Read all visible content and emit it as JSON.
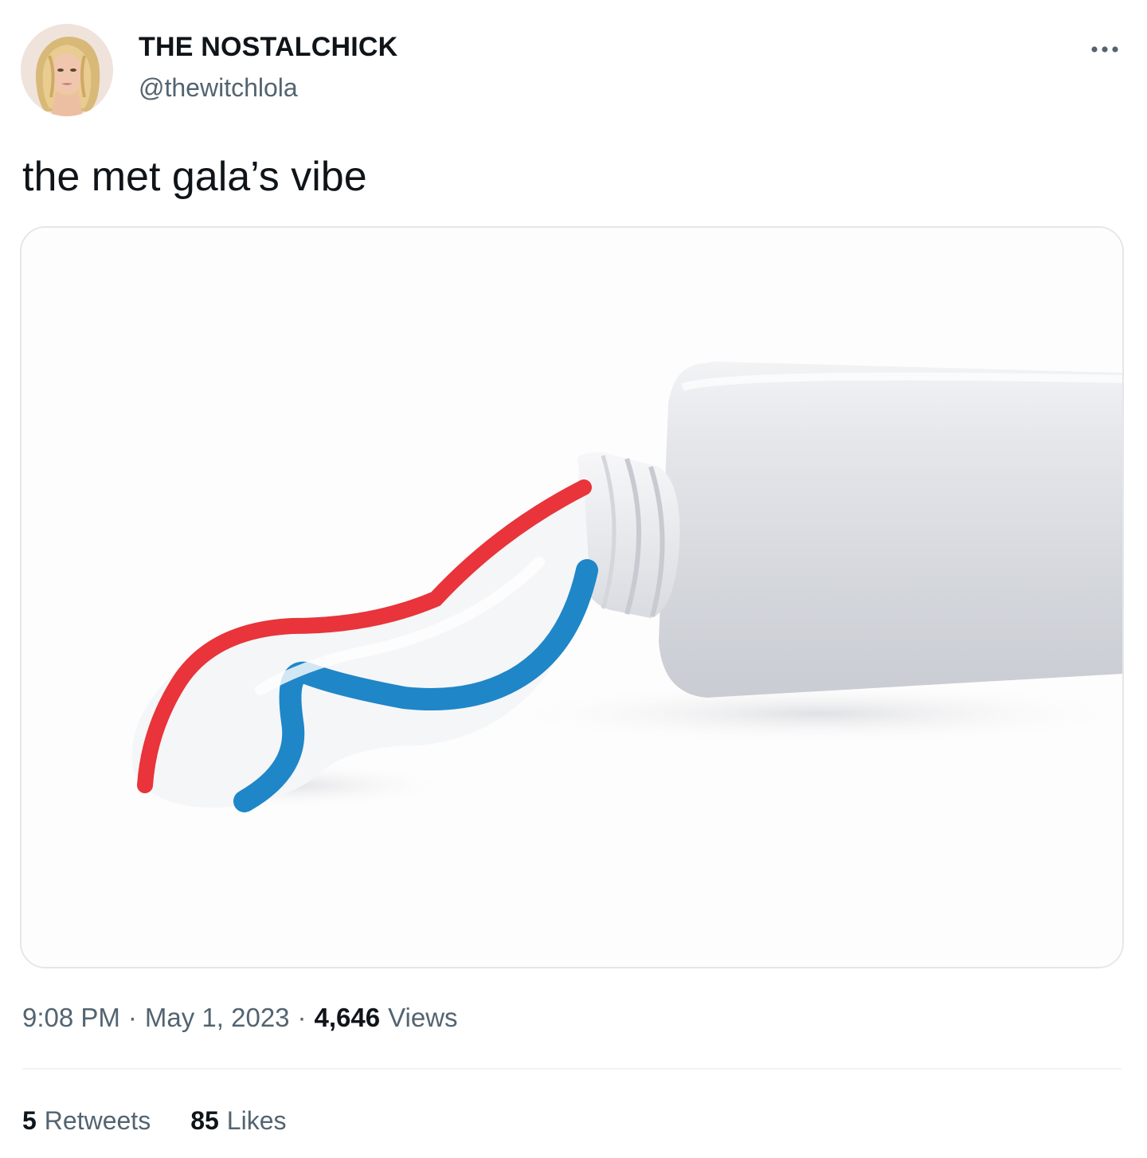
{
  "tweet": {
    "author": {
      "display_name": "THE NOSTALCHICK",
      "handle": "@thewitchlola",
      "avatar": "avatar-image"
    },
    "more_icon": "more-horizontal-icon",
    "text": "the met gala’s vibe",
    "media": {
      "description_icon": "toothpaste-image"
    },
    "meta": {
      "time": "9:08 PM",
      "separator": "·",
      "date": "May 1, 2023",
      "views_count": "4,646",
      "views_label": "Views"
    },
    "stats": {
      "retweets_count": "5",
      "retweets_label": "Retweets",
      "likes_count": "85",
      "likes_label": "Likes"
    },
    "colors": {
      "primary_text": "#0f1419",
      "secondary_text": "#536471",
      "border": "#e4e7ea",
      "stripe_red": "#e8343a",
      "stripe_blue": "#1f86c8"
    }
  }
}
